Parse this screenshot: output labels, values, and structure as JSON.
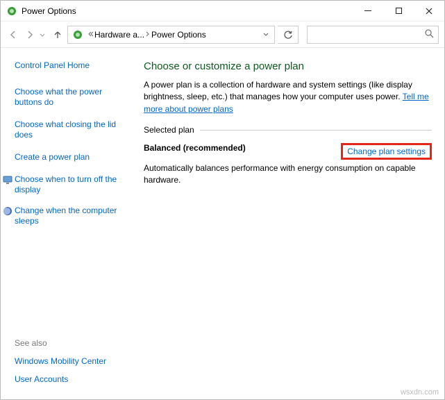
{
  "window": {
    "title": "Power Options"
  },
  "breadcrumb": {
    "seg1": "Hardware a...",
    "seg2": "Power Options"
  },
  "search": {
    "placeholder": ""
  },
  "sidebar": {
    "home": "Control Panel Home",
    "links": {
      "0": "Choose what the power buttons do",
      "1": "Choose what closing the lid does",
      "2": "Create a power plan",
      "3": "Choose when to turn off the display",
      "4": "Change when the computer sleeps"
    },
    "seealso": "See also",
    "bottom": {
      "0": "Windows Mobility Center",
      "1": "User Accounts"
    }
  },
  "main": {
    "heading": "Choose or customize a power plan",
    "desc_pre": "A power plan is a collection of hardware and system settings (like display brightness, sleep, etc.) that manages how your computer uses power. ",
    "tell_more": "Tell me more about power plans",
    "section_label": "Selected plan",
    "plan_name": "Balanced (recommended)",
    "change_link": "Change plan settings",
    "plan_desc": "Automatically balances performance with energy consumption on capable hardware."
  },
  "watermark": "wsxdn.com"
}
